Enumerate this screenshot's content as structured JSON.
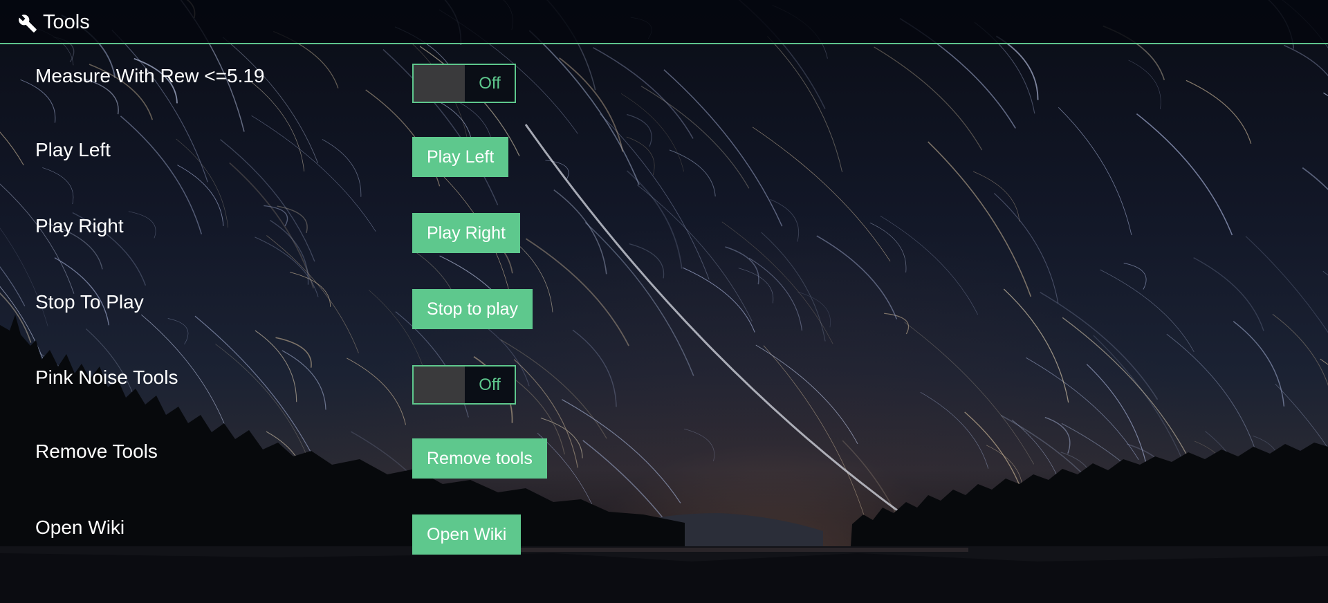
{
  "header": {
    "icon": "wrench-icon",
    "title": "Tools"
  },
  "rows": [
    {
      "label": "Measure With Rew <=5.19",
      "control": "toggle",
      "value": "Off"
    },
    {
      "label": "Play Left",
      "control": "button",
      "value": "Play Left"
    },
    {
      "label": "Play Right",
      "control": "button",
      "value": "Play Right"
    },
    {
      "label": "Stop To Play",
      "control": "button",
      "value": "Stop to play"
    },
    {
      "label": "Pink Noise Tools",
      "control": "toggle",
      "value": "Off"
    },
    {
      "label": "Remove Tools",
      "control": "button",
      "value": "Remove tools"
    },
    {
      "label": "Open Wiki",
      "control": "button",
      "value": "Open Wiki"
    }
  ],
  "colors": {
    "accent": "#5ec88d",
    "header_bg": "#04060e",
    "toggle_knob": "#3a3a3c",
    "text": "#ffffff"
  }
}
